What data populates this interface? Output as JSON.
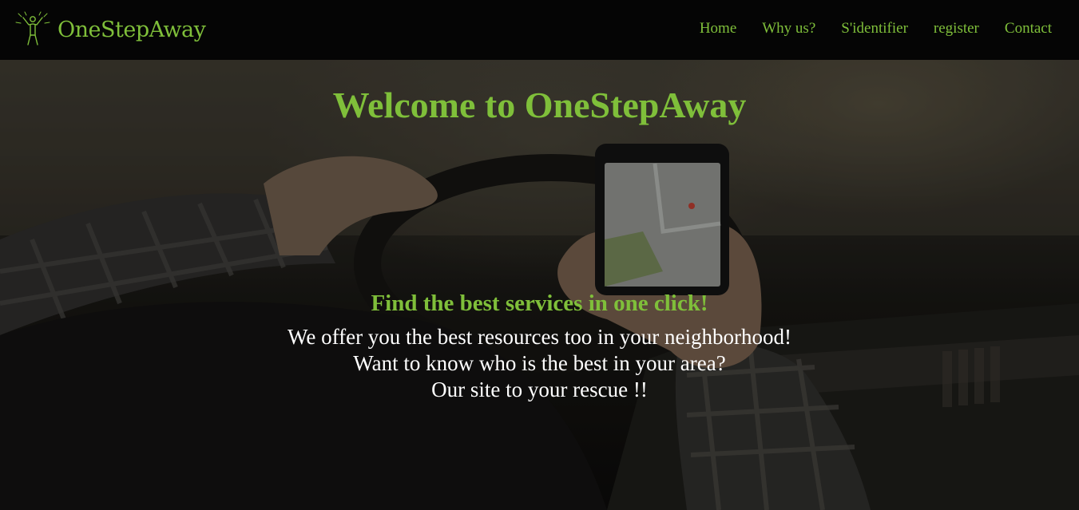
{
  "brand": {
    "name": "OneStepAway",
    "icon": "person-arms-raised-icon",
    "accent_color": "#7fbf3a"
  },
  "nav": {
    "items": [
      {
        "label": "Home"
      },
      {
        "label": "Why us?"
      },
      {
        "label": "S'identifier"
      },
      {
        "label": "register"
      },
      {
        "label": "Contact"
      }
    ]
  },
  "hero": {
    "title": "Welcome to OneStepAway",
    "tagline": "Find the best services in one click!",
    "lines": [
      "We offer you the best resources too in your neighborhood!",
      "Want to know who is the best in your area?",
      "Our site to your rescue !!"
    ],
    "background_image": "driver-using-phone-map-photo"
  }
}
